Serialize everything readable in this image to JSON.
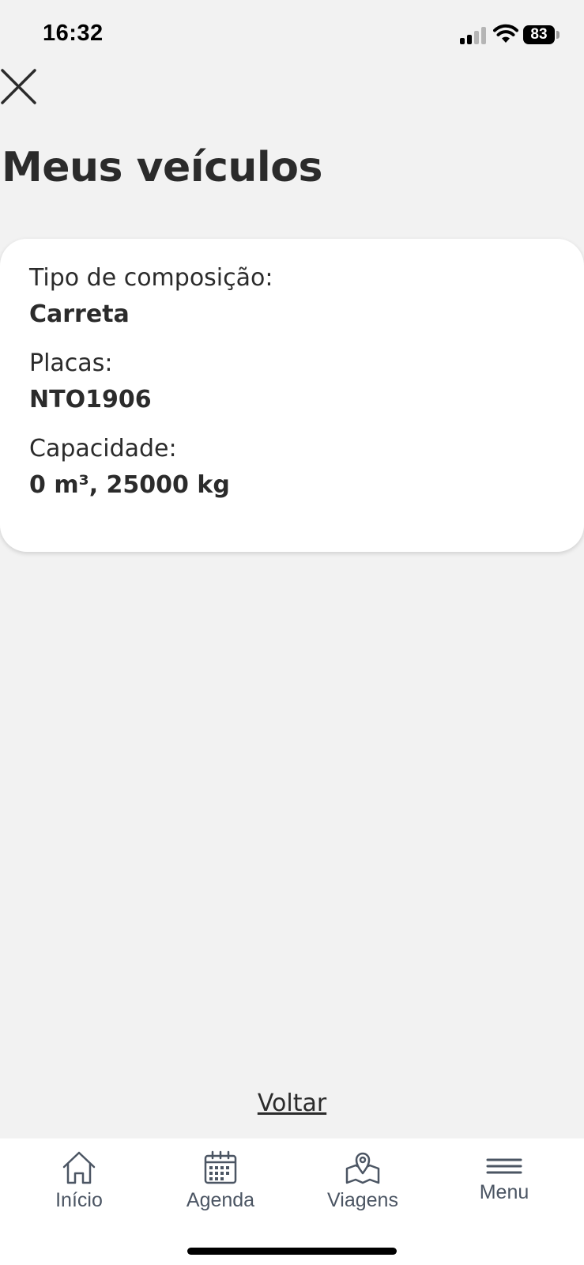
{
  "status_bar": {
    "time": "16:32",
    "battery": "83"
  },
  "page": {
    "title": "Meus veículos",
    "back_label": "Voltar"
  },
  "vehicle": {
    "composition_label": "Tipo de composição:",
    "composition_value": "Carreta",
    "plates_label": "Placas:",
    "plates_value": "NTO1906",
    "capacity_label": "Capacidade:",
    "capacity_value": "0 m³, 25000 kg"
  },
  "bottom_nav": {
    "items": [
      {
        "label": "Início",
        "icon": "home-icon"
      },
      {
        "label": "Agenda",
        "icon": "calendar-icon"
      },
      {
        "label": "Viagens",
        "icon": "map-pin-icon"
      },
      {
        "label": "Menu",
        "icon": "hamburger-menu-icon"
      }
    ]
  },
  "colors": {
    "background": "#f2f2f2",
    "card": "#ffffff",
    "text": "#2b2b2b",
    "nav_text": "#4b5563"
  }
}
